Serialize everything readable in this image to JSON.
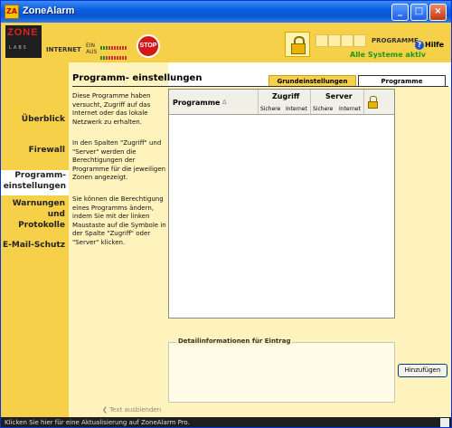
{
  "window": {
    "title": "ZoneAlarm",
    "icon_text": "ZA"
  },
  "header": {
    "logo_text": "ZONE",
    "logo_sub": "LABS",
    "internet_label": "INTERNET",
    "in_label": "EIN",
    "out_label": "AUS",
    "stop_label": "STOP",
    "programs_label": "PROGRAMME",
    "status_text": "Alle Systeme aktiv",
    "help_label": "Hilfe"
  },
  "sidebar": {
    "items": [
      {
        "label": "Überblick"
      },
      {
        "label": "Firewall"
      },
      {
        "label": "Programm-\neinstellungen"
      },
      {
        "label": "Warnungen\nund\nProtokolle"
      },
      {
        "label": "E-Mail-Schutz"
      }
    ]
  },
  "page": {
    "title": "Programm- einstellungen",
    "tabs": [
      {
        "label": "Grundeinstellungen"
      },
      {
        "label": "Programme"
      }
    ]
  },
  "info": {
    "para1": "Diese Programme haben versucht, Zugriff auf das Internet oder das lokale Netzwerk zu erhalten.",
    "para2": "In den Spalten \"Zugriff\" und \"Server\" werden die Berechtigungen der Programme für die jeweiligen Zonen angezeigt.",
    "para3": "Sie können die Berechtigung eines Programms ändern, indem Sie mit der linken Maustaste auf die Symbole in der Spalte \"Zugriff\" oder \"Server\" klicken.",
    "hide_text": "Text ausblenden"
  },
  "table": {
    "col_programs": "Programme",
    "col_access": "Zugriff",
    "col_server": "Server",
    "sub_trusted": "Sichere",
    "sub_internet": "Internet"
  },
  "detail": {
    "legend": "Detailinformationen für Eintrag"
  },
  "buttons": {
    "add": "Hinzufügen"
  },
  "statusbar": {
    "text": "Klicken Sie hier für eine Aktualisierung auf ZoneAlarm Pro."
  },
  "colors": {
    "header_yellow": "#f7d04a",
    "panel_cream": "#fff3bd",
    "status_green": "#1a9a1a",
    "stop_red": "#d41818"
  }
}
